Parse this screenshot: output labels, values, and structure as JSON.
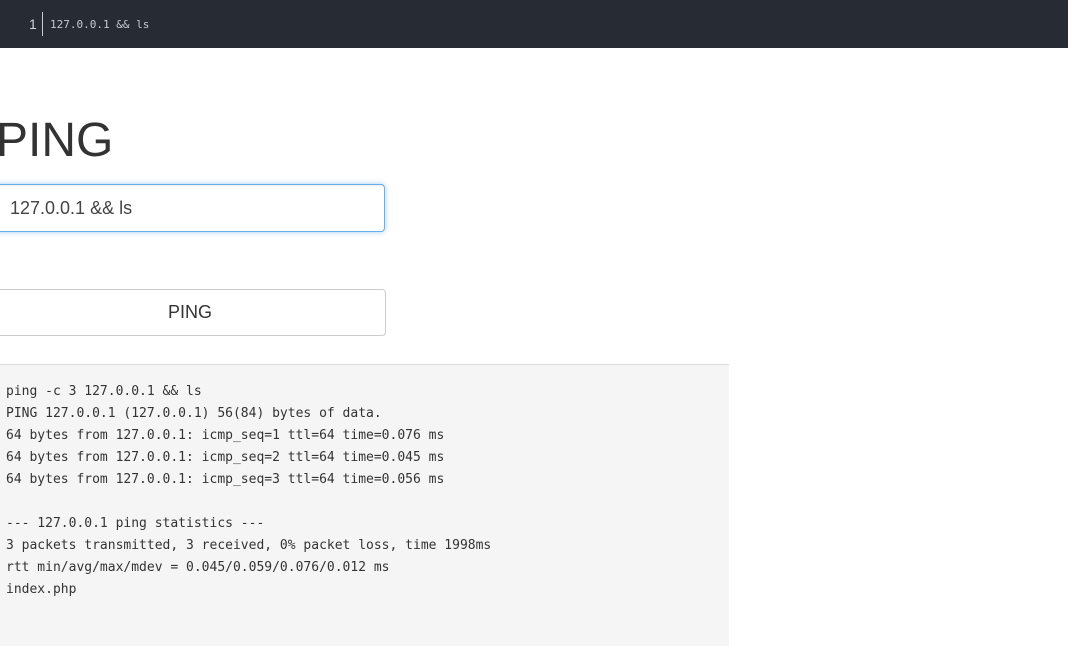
{
  "editor_bar": {
    "line_number": "1",
    "code": "127.0.0.1 && ls"
  },
  "page": {
    "title": "PING"
  },
  "form": {
    "ip_value": "127.0.0.1 && ls",
    "submit_label": "PING"
  },
  "output": {
    "lines": [
      "ping -c 3 127.0.0.1 && ls",
      "PING 127.0.0.1 (127.0.0.1) 56(84) bytes of data.",
      "64 bytes from 127.0.0.1: icmp_seq=1 ttl=64 time=0.076 ms",
      "64 bytes from 127.0.0.1: icmp_seq=2 ttl=64 time=0.045 ms",
      "64 bytes from 127.0.0.1: icmp_seq=3 ttl=64 time=0.056 ms",
      "",
      "--- 127.0.0.1 ping statistics ---",
      "3 packets transmitted, 3 received, 0% packet loss, time 1998ms",
      "rtt min/avg/max/mdev = 0.045/0.059/0.076/0.012 ms",
      "index.php"
    ]
  },
  "colors": {
    "editor_background": "#272b33",
    "input_focus_border": "#66afe9",
    "output_background": "#f5f5f5"
  }
}
